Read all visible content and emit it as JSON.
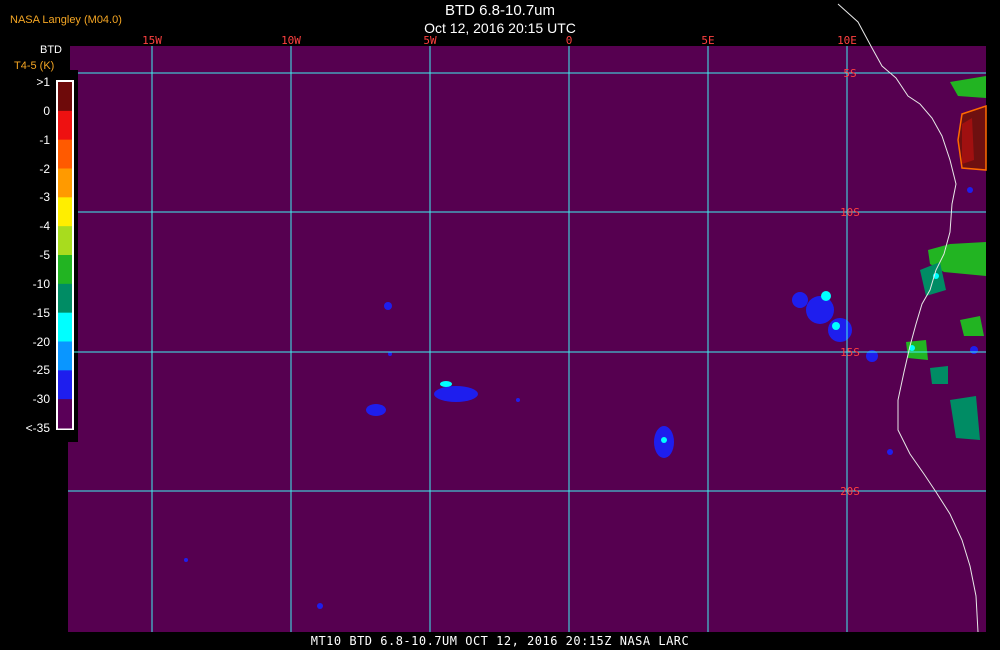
{
  "header": {
    "agency": "NASA Langley (M04.0)",
    "title": "BTD 6.8-10.7um",
    "timestamp": "Oct 12, 2016 20:15 UTC"
  },
  "legend": {
    "title": "BTD",
    "unit": "T4-5 (K)",
    "labels": [
      ">1",
      "0",
      "-1",
      "-2",
      "-3",
      "-4",
      "-5",
      "-10",
      "-15",
      "-20",
      "-25",
      "-30",
      "<-35"
    ],
    "colors": [
      "#6e0a0a",
      "#ee1111",
      "#ff5a00",
      "#ff9a00",
      "#ffee00",
      "#a8dc1e",
      "#22b422",
      "#008c64",
      "#00ffff",
      "#0a96ff",
      "#1e1eee",
      "#5a0058"
    ]
  },
  "map": {
    "background": "#560050",
    "grid_color": "#3ff0f0",
    "coast_color": "#e8e8e8",
    "lon_labels": [
      "15W",
      "10W",
      "5W",
      "0",
      "5E",
      "10E"
    ],
    "lat_labels": [
      "5S",
      "10S",
      "15S",
      "20S"
    ]
  },
  "footer": {
    "text": "MT10   BTD 6.8-10.7UM   OCT 12, 2016 20:15Z   NASA LARC"
  }
}
